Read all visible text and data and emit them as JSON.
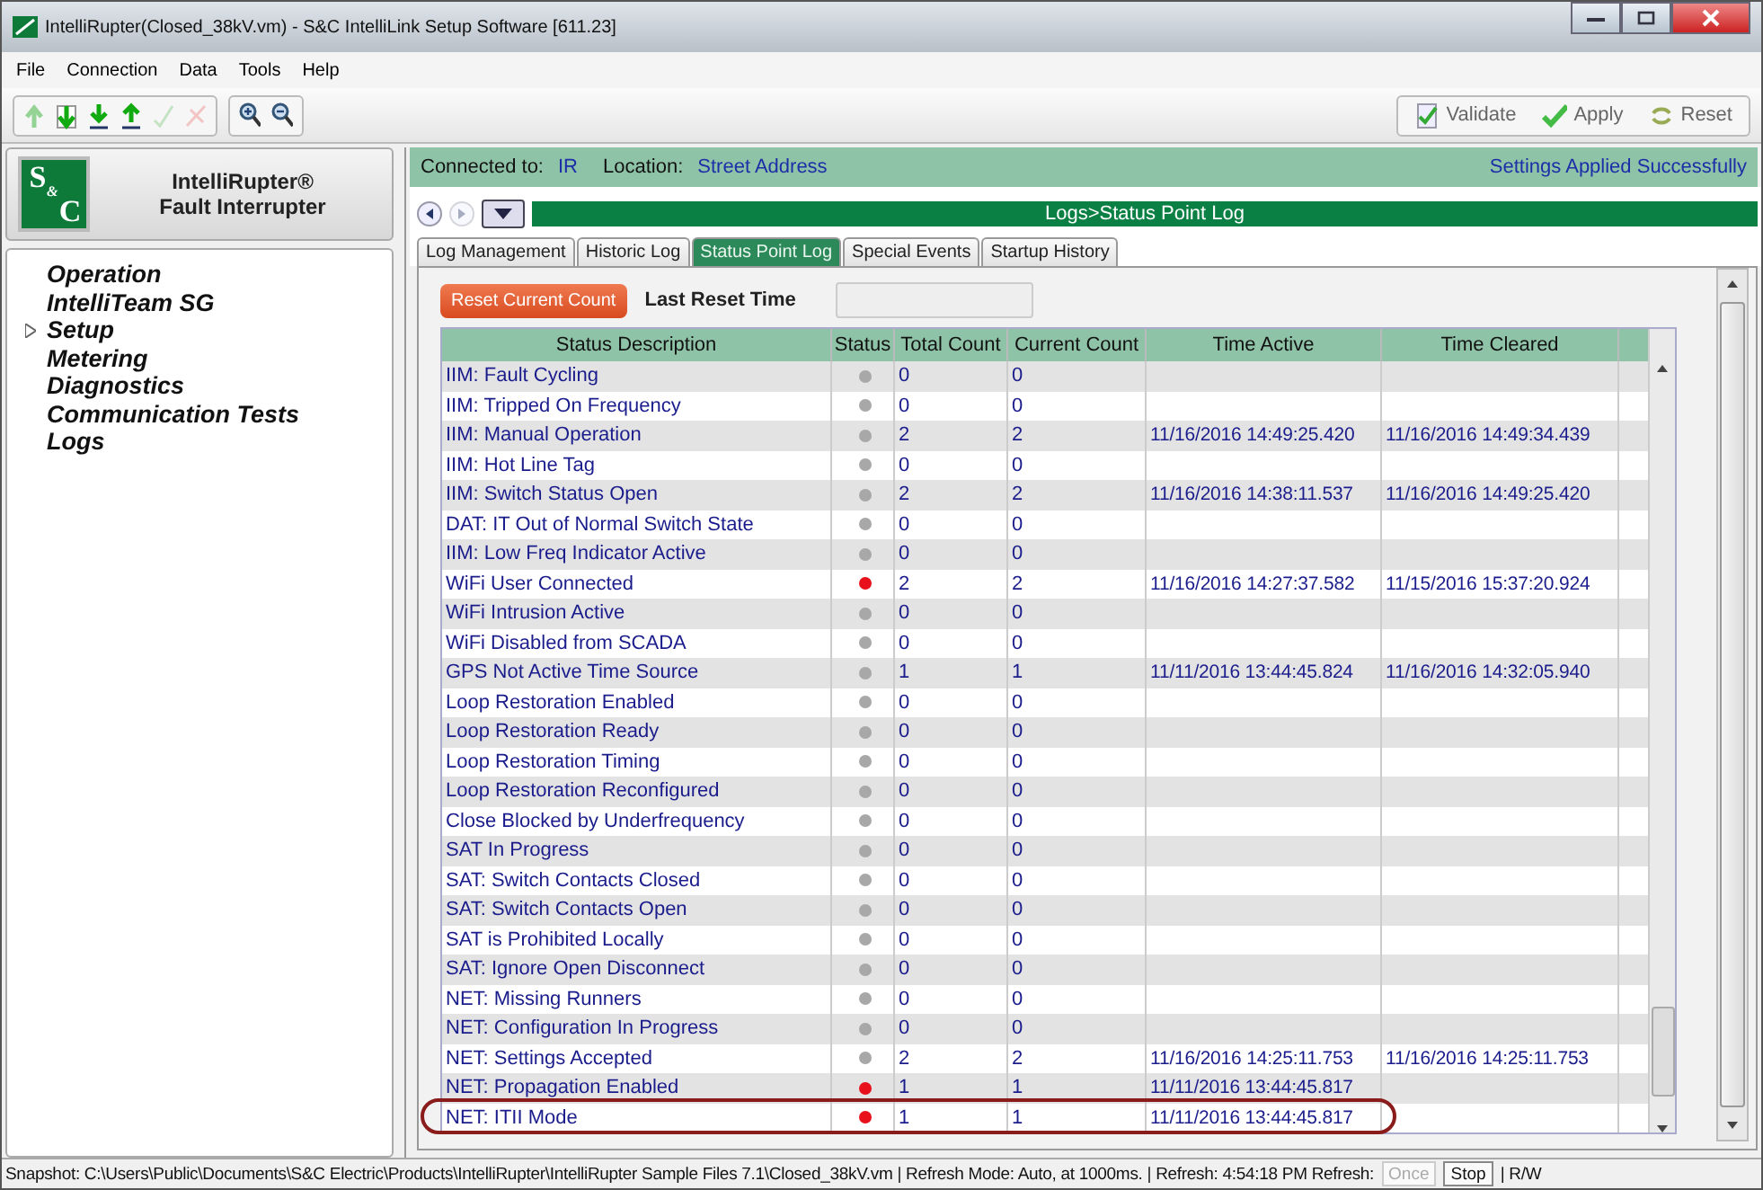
{
  "window": {
    "title": "IntelliRupter(Closed_38kV.vm) - S&C IntelliLink Setup Software [611.23]"
  },
  "menu": [
    "File",
    "Connection",
    "Data",
    "Tools",
    "Help"
  ],
  "toolbar": [
    {
      "kind": "up",
      "disabled": true
    },
    {
      "kind": "down",
      "disabled": false
    },
    {
      "kind": "down-line",
      "disabled": false
    },
    {
      "kind": "up-line",
      "disabled": false
    },
    {
      "kind": "check",
      "disabled": true
    },
    {
      "kind": "cross",
      "disabled": true
    },
    {
      "kind": "zoom-in",
      "disabled": false
    },
    {
      "kind": "zoom-out",
      "disabled": false
    }
  ],
  "actions": [
    {
      "kind": "validate",
      "label": "Validate"
    },
    {
      "kind": "apply",
      "label": "Apply"
    },
    {
      "kind": "reset",
      "label": "Reset"
    }
  ],
  "logo": {
    "letters": [
      "S",
      "&",
      "C"
    ],
    "title": "IntelliRupter®",
    "subtitle": "Fault Interrupter"
  },
  "sidebar": {
    "items": [
      {
        "label": "Operation",
        "expandable": false
      },
      {
        "label": "IntelliTeam SG",
        "expandable": false
      },
      {
        "label": "Setup",
        "expandable": true
      },
      {
        "label": "Metering",
        "expandable": false
      },
      {
        "label": "Diagnostics",
        "expandable": false
      },
      {
        "label": "Communication Tests",
        "expandable": false
      },
      {
        "label": "Logs",
        "expandable": false
      }
    ]
  },
  "connection": {
    "connected_label": "Connected to:",
    "connected_value": "IR",
    "location_label": "Location:",
    "location_value": "Street Address",
    "message": "Settings Applied Successfully"
  },
  "nav": {
    "back_disabled": false,
    "forward_disabled": true,
    "breadcrumb": "Logs>Status Point Log"
  },
  "tabs": [
    {
      "label": "Log Management",
      "selected": false
    },
    {
      "label": "Historic Log",
      "selected": false
    },
    {
      "label": "Status Point Log",
      "selected": true
    },
    {
      "label": "Special Events",
      "selected": false
    },
    {
      "label": "Startup History",
      "selected": false
    }
  ],
  "reset_button": "Reset Current Count",
  "last_reset_label": "Last Reset Time",
  "table": {
    "columns": [
      "Status Description",
      "Status",
      "Total Count",
      "Current Count",
      "Time Active",
      "Time Cleared"
    ],
    "rows": [
      {
        "description": "IIM: Fault Cycling",
        "active": false,
        "total": "0",
        "current": "0",
        "highlighted": false
      },
      {
        "description": "IIM: Tripped On Frequency",
        "active": false,
        "total": "0",
        "current": "0",
        "highlighted": false
      },
      {
        "description": "IIM: Manual Operation",
        "active": false,
        "total": "2",
        "current": "2",
        "time_active": "11/16/2016 14:49:25.420",
        "time_cleared": "11/16/2016 14:49:34.439",
        "highlighted": false
      },
      {
        "description": "IIM: Hot Line Tag",
        "active": false,
        "total": "0",
        "current": "0",
        "highlighted": false
      },
      {
        "description": "IIM: Switch Status Open",
        "active": false,
        "total": "2",
        "current": "2",
        "time_active": "11/16/2016 14:38:11.537",
        "time_cleared": "11/16/2016 14:49:25.420",
        "highlighted": false
      },
      {
        "description": "DAT: IT Out of Normal Switch State",
        "active": false,
        "total": "0",
        "current": "0",
        "highlighted": false
      },
      {
        "description": "IIM: Low Freq Indicator Active",
        "active": false,
        "total": "0",
        "current": "0",
        "highlighted": false
      },
      {
        "description": "WiFi User Connected",
        "active": true,
        "total": "2",
        "current": "2",
        "time_active": "11/16/2016 14:27:37.582",
        "time_cleared": "11/15/2016 15:37:20.924",
        "highlighted": false
      },
      {
        "description": "WiFi Intrusion Active",
        "active": false,
        "total": "0",
        "current": "0",
        "highlighted": false
      },
      {
        "description": "WiFi Disabled from SCADA",
        "active": false,
        "total": "0",
        "current": "0",
        "highlighted": false
      },
      {
        "description": "GPS Not Active Time Source",
        "active": false,
        "total": "1",
        "current": "1",
        "time_active": "11/11/2016 13:44:45.824",
        "time_cleared": "11/16/2016 14:32:05.940",
        "highlighted": false
      },
      {
        "description": "Loop Restoration Enabled",
        "active": false,
        "total": "0",
        "current": "0",
        "highlighted": false
      },
      {
        "description": "Loop Restoration Ready",
        "active": false,
        "total": "0",
        "current": "0",
        "highlighted": false
      },
      {
        "description": "Loop Restoration Timing",
        "active": false,
        "total": "0",
        "current": "0",
        "highlighted": false
      },
      {
        "description": "Loop Restoration Reconfigured",
        "active": false,
        "total": "0",
        "current": "0",
        "highlighted": false
      },
      {
        "description": "Close Blocked by Underfrequency",
        "active": false,
        "total": "0",
        "current": "0",
        "highlighted": false
      },
      {
        "description": "SAT In Progress",
        "active": false,
        "total": "0",
        "current": "0",
        "highlighted": false
      },
      {
        "description": "SAT: Switch Contacts Closed",
        "active": false,
        "total": "0",
        "current": "0",
        "highlighted": false
      },
      {
        "description": "SAT: Switch Contacts Open",
        "active": false,
        "total": "0",
        "current": "0",
        "highlighted": false
      },
      {
        "description": "SAT is Prohibited Locally",
        "active": false,
        "total": "0",
        "current": "0",
        "highlighted": false
      },
      {
        "description": "SAT: Ignore Open Disconnect",
        "active": false,
        "total": "0",
        "current": "0",
        "highlighted": false
      },
      {
        "description": "NET: Missing Runners",
        "active": false,
        "total": "0",
        "current": "0",
        "highlighted": false
      },
      {
        "description": "NET: Configuration In Progress",
        "active": false,
        "total": "0",
        "current": "0",
        "highlighted": false
      },
      {
        "description": "NET: Settings Accepted",
        "active": false,
        "total": "2",
        "current": "2",
        "time_active": "11/16/2016 14:25:11.753",
        "time_cleared": "11/16/2016 14:25:11.753",
        "highlighted": false
      },
      {
        "description": "NET: Propagation Enabled",
        "active": true,
        "total": "1",
        "current": "1",
        "time_active": "11/11/2016 13:44:45.817",
        "highlighted": false
      },
      {
        "description": "NET: ITII Mode",
        "active": true,
        "total": "1",
        "current": "1",
        "time_active": "11/11/2016 13:44:45.817",
        "highlighted": true
      }
    ]
  },
  "status_bar": {
    "text": "Snapshot: C:\\Users\\Public\\Documents\\S&C Electric\\Products\\IntelliRupter\\IntelliRupter Sample Files 7.1\\Closed_38kV.vm | Refresh Mode: Auto, at 1000ms. | Refresh: 4:54:18 PM  Refresh:",
    "buttons": [
      {
        "label": "Once",
        "disabled": true
      },
      {
        "label": "Stop",
        "disabled": false
      }
    ],
    "mode": "| R/W"
  }
}
